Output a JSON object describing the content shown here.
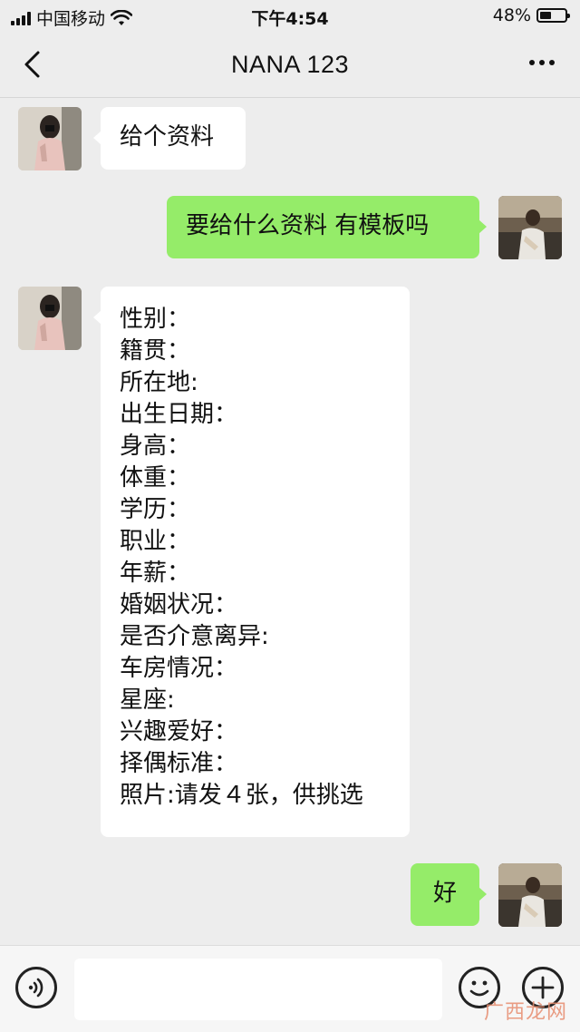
{
  "status_bar": {
    "carrier": "中国移动",
    "time": "下午4:54",
    "battery_text": "48%",
    "battery_level": 0.48,
    "icons": [
      "signal-icon",
      "wifi-icon",
      "battery-icon"
    ]
  },
  "nav": {
    "title": "NANA 123",
    "icons": [
      "back-arrow-icon",
      "more-dots-icon"
    ]
  },
  "messages": [
    {
      "from": "contact",
      "text": "给个资料"
    },
    {
      "from": "me",
      "text": "要给什么资料 有模板吗"
    },
    {
      "from": "contact",
      "lines": [
        "性别：",
        "籍贯：",
        "所在地:",
        "出生日期：",
        "身高：",
        "体重：",
        "学历：",
        "职业：",
        "年薪：",
        "婚姻状况：",
        "是否介意离异:",
        "车房情况：",
        "星座:",
        "兴趣爱好：",
        "择偶标准：",
        "照片:请发４张，供挑选"
      ]
    },
    {
      "from": "me",
      "text": "好"
    }
  ],
  "input_bar": {
    "placeholder": "",
    "icons": [
      "voice-icon",
      "emoji-icon",
      "plus-icon"
    ]
  },
  "watermark": "广西龙网"
}
